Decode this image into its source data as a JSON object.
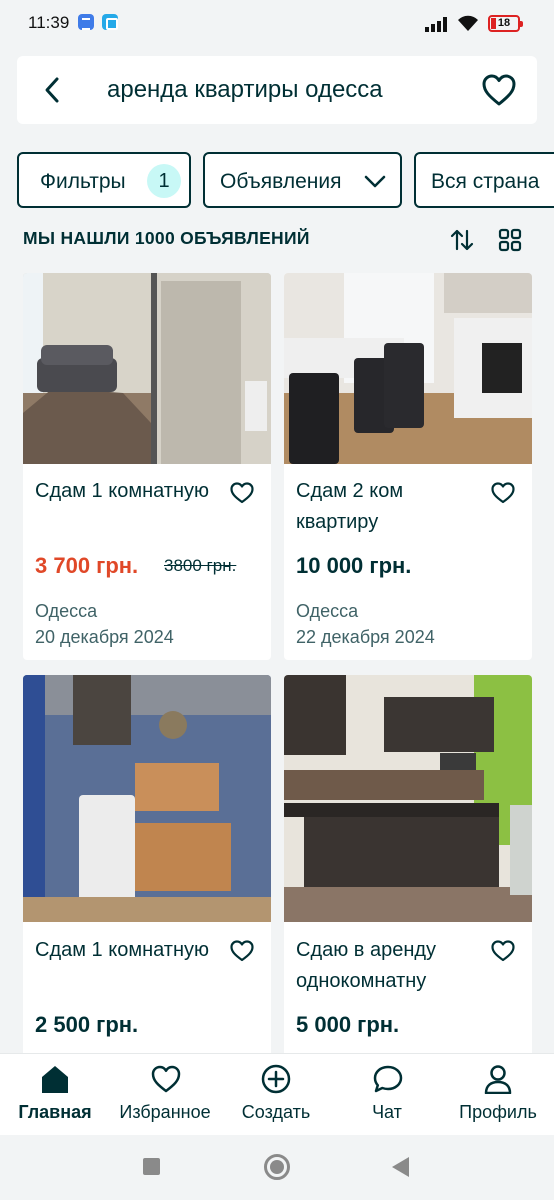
{
  "status_bar": {
    "time": "11:39",
    "battery": "18"
  },
  "search": {
    "query": "аренда квартиры одесса"
  },
  "filters": {
    "filters_label": "Фильтры",
    "filters_count": "1",
    "ads_label": "Объявления",
    "region_label": "Вся страна"
  },
  "results": {
    "count_text": "МЫ НАШЛИ 1000 ОБЪЯВЛЕНИЙ"
  },
  "listings": [
    {
      "title": "Сдам 1 комнатную",
      "price": "3 700 грн.",
      "old_price": "3800 грн.",
      "city": "Одесса",
      "date": "20 декабря 2024"
    },
    {
      "title": "Сдам 2 ком квартиру",
      "price": "10 000 грн.",
      "city": "Одесса",
      "date": "22 декабря 2024"
    },
    {
      "title": "Сдам 1 комнатную",
      "price": "2 500 грн."
    },
    {
      "title": "Сдаю в аренду однокомнатну",
      "price": "5 000 грн."
    }
  ],
  "bottom_nav": [
    {
      "label": "Главная",
      "icon": "home-icon",
      "active": true
    },
    {
      "label": "Избранное",
      "icon": "heart-icon"
    },
    {
      "label": "Создать",
      "icon": "plus-circle-icon"
    },
    {
      "label": "Чат",
      "icon": "chat-bubble-icon"
    },
    {
      "label": "Профиль",
      "icon": "user-icon"
    }
  ],
  "colors": {
    "primary": "#002f34",
    "sale_price": "#e04828",
    "badge": "#c8f8f6",
    "secondary_text": "#406367"
  }
}
